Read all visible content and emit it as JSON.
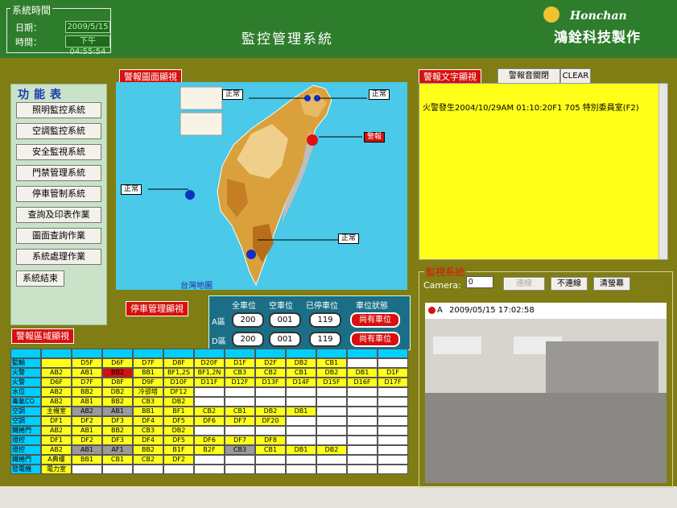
{
  "system_time": {
    "legend": "系統時間",
    "date_label": "日期：",
    "date_value": "2009/5/15",
    "time_label": "時間：",
    "time_value": "下午 04:55:54"
  },
  "title": "監控管理系統",
  "logo": {
    "en": "Honchan",
    "zh": "鴻銓科技製作"
  },
  "menu": {
    "title": "功能表",
    "items": [
      "照明監控系統",
      "空調監控系統",
      "安全監視系統",
      "門禁管理系統",
      "停車管制系統",
      "查詢及印表作業",
      "圖面查詢作業",
      "系統處理作業",
      "系統結束"
    ]
  },
  "map": {
    "label": "警報圖面顯視",
    "caption": "台灣地圖",
    "statuses": [
      "正常",
      "正常",
      "警報",
      "正常",
      "正常"
    ]
  },
  "alarm_text": {
    "label": "警報文字顯視",
    "sound_button": "警報音關閉",
    "clear_button": "CLEAR",
    "message": "火警發生2004/10/29AM 01:10:20F1 705 特別委員室(F2)"
  },
  "parking": {
    "label": "停車管理顯視",
    "headers": [
      "全車位",
      "空車位",
      "已停車位",
      "車位狀態"
    ],
    "rows": [
      {
        "name": "A區",
        "values": [
          "200",
          "001",
          "119"
        ],
        "status": "尚有車位"
      },
      {
        "name": "D區",
        "values": [
          "200",
          "001",
          "119"
        ],
        "status": "尚有車位"
      }
    ]
  },
  "camera": {
    "label": "監視系統",
    "camera_label": "Camera:",
    "camera_value": "0",
    "connect": "連線",
    "disconnect": "不連線",
    "clear_screen": "清螢幕",
    "timestamp": "2009/05/15 17:02:58",
    "channel": "A"
  },
  "zone": {
    "label": "警報區域顯視",
    "rows": [
      {
        "name": "監輸",
        "cells": [
          "",
          "D5F",
          "D6F",
          "D7F",
          "D8F",
          "D20F",
          "D1F",
          "D2F",
          "DB2",
          "CB1",
          "",
          ""
        ]
      },
      {
        "name": "火警",
        "cells": [
          "AB2",
          "AB1",
          "BB2",
          "BB1",
          "BF1,2S",
          "BF1,2N",
          "CB3",
          "CB2",
          "CB1",
          "DB2",
          "DB1",
          "D1F"
        ]
      },
      {
        "name": "火警",
        "cells": [
          "D6F",
          "D7F",
          "D8F",
          "D9F",
          "D10F",
          "D11F",
          "D12F",
          "D13F",
          "D14F",
          "D15F",
          "D16F",
          "D17F"
        ]
      },
      {
        "name": "水位",
        "cells": [
          "AB2",
          "BB2",
          "DB2",
          "冷卻塔",
          "DF12",
          "",
          "",
          "",
          "",
          "",
          "",
          ""
        ]
      },
      {
        "name": "毒氣CO",
        "cells": [
          "AB2",
          "AB1",
          "BB2",
          "CB3",
          "DB2",
          "",
          "",
          "",
          "",
          "",
          "",
          ""
        ]
      },
      {
        "name": "空調",
        "cells": [
          "主機室",
          "AB2",
          "AB1",
          "BB1",
          "BF1",
          "CB2",
          "CB1",
          "DB2",
          "DB1",
          "",
          "",
          ""
        ]
      },
      {
        "name": "空調",
        "cells": [
          "DF1",
          "DF2",
          "DF3",
          "DF4",
          "DF5",
          "DF6",
          "DF7",
          "DF20",
          "",
          "",
          "",
          ""
        ]
      },
      {
        "name": "鐵捲門",
        "cells": [
          "AB2",
          "AB1",
          "BB2",
          "CB3",
          "DB2",
          "",
          "",
          "",
          "",
          "",
          "",
          ""
        ]
      },
      {
        "name": "燈控",
        "cells": [
          "DF1",
          "DF2",
          "DF3",
          "DF4",
          "DF5",
          "DF6",
          "DF7",
          "DF8",
          "",
          "",
          "",
          ""
        ]
      },
      {
        "name": "燈控",
        "cells": [
          "AB2",
          "AB1",
          "AF1",
          "BB2",
          "B1F",
          "B2F",
          "CB3",
          "CB1",
          "DB1",
          "DB2",
          "",
          ""
        ]
      },
      {
        "name": "鐵捲門",
        "cells": [
          "A典樓",
          "BB1",
          "CB1",
          "CB2",
          "DF2",
          "",
          "",
          "",
          "",
          "",
          "",
          ""
        ]
      },
      {
        "name": "發電機",
        "cells": [
          "電力室",
          "",
          "",
          "",
          "",
          "",
          "",
          "",
          "",
          "",
          "",
          ""
        ]
      }
    ]
  },
  "colors": {
    "header": "#2e7d2c",
    "band": "#7f7d14",
    "alarm_yellow": "#ffff1a",
    "red": "#d80f0f",
    "cyan": "#00cfff",
    "parking": "#1a6f86"
  }
}
